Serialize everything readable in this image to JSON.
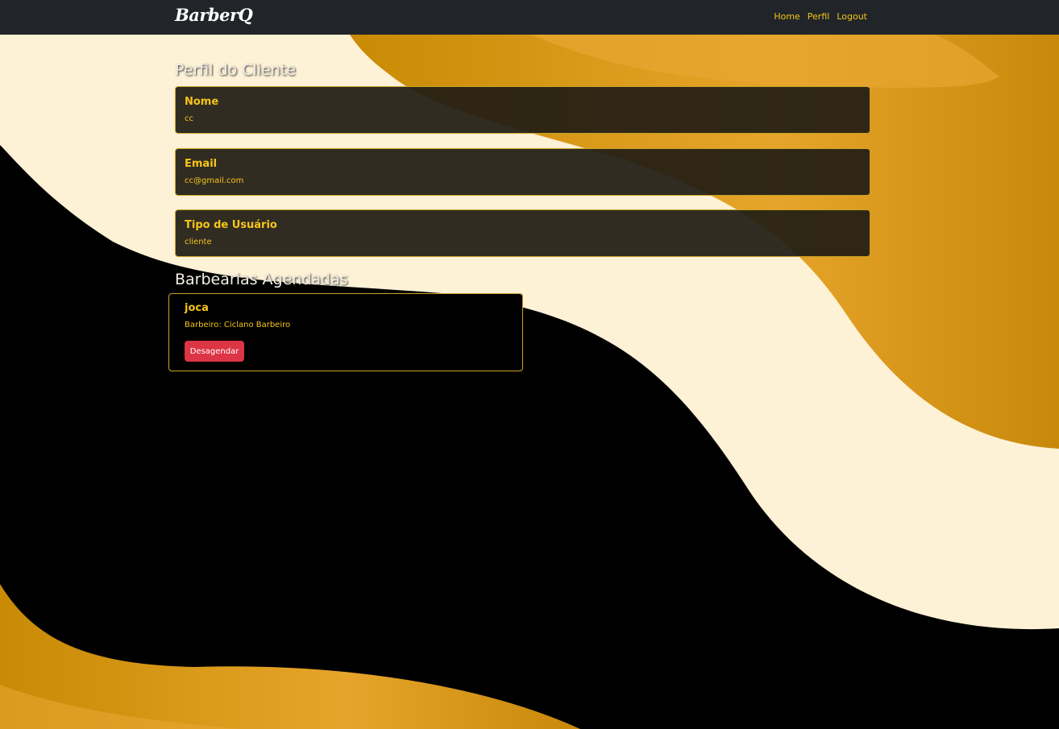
{
  "navbar": {
    "brand": "BarberQ",
    "links": [
      "Home",
      "Perfil",
      "Logout"
    ]
  },
  "profile": {
    "title": "Perfil do Cliente",
    "fields": [
      {
        "label": "Nome",
        "value": "cc"
      },
      {
        "label": "Email",
        "value": "cc@gmail.com"
      },
      {
        "label": "Tipo de Usuário",
        "value": "cliente"
      }
    ]
  },
  "appointments": {
    "title": "Barbearias Agendadas",
    "items": [
      {
        "name": "joca",
        "barber": "Barbeiro: Ciclano Barbeiro",
        "action": "Desagendar"
      }
    ]
  },
  "colors": {
    "accent": "#f5c518",
    "navbar_bg": "#212529",
    "card_border": "#c9a227",
    "danger": "#dc3545",
    "wave_cream": "#fdf1d6",
    "wave_gold": "#d9961c"
  }
}
